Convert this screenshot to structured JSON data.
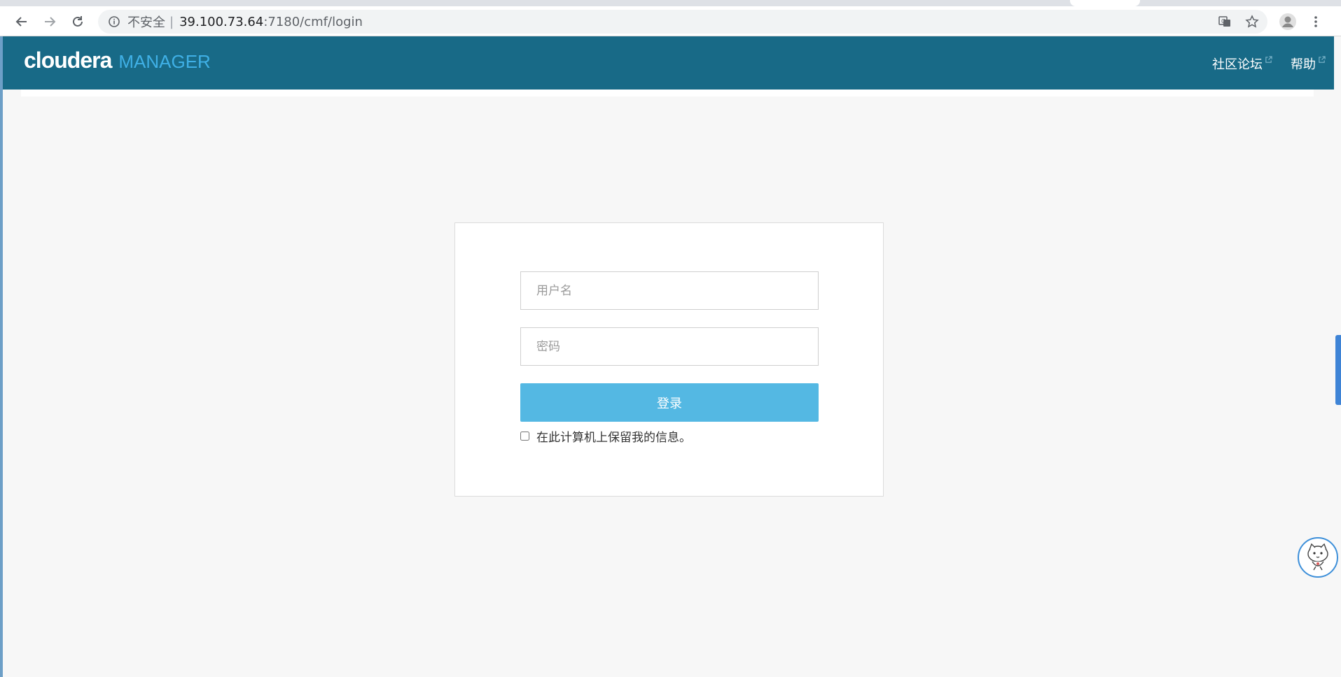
{
  "browser": {
    "security_label": "不安全",
    "separator": "|",
    "url_host": "39.100.73.64",
    "url_rest": ":7180/cmf/login"
  },
  "header": {
    "brand_main": "cloudera",
    "brand_sub": "MANAGER",
    "links": [
      "社区论坛",
      "帮助"
    ],
    "bg_color": "#186a87",
    "accent_color": "#3fb0e6"
  },
  "login": {
    "username_placeholder": "用户名",
    "password_placeholder": "密码",
    "submit_label": "登录",
    "remember_label": "在此计算机上保留我的信息。",
    "button_color": "#54b8e3"
  },
  "icons": {
    "back": "arrow-left-icon",
    "forward": "arrow-right-icon",
    "reload": "reload-icon",
    "info": "info-icon",
    "translate": "translate-icon",
    "bookmark": "star-icon",
    "profile": "profile-icon",
    "menu": "kebab-menu-icon",
    "external": "external-link-icon"
  }
}
